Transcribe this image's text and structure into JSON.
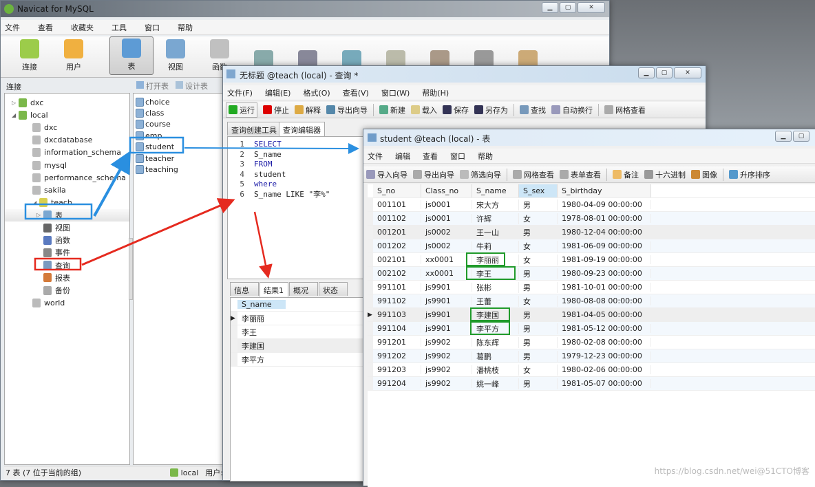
{
  "main_window": {
    "title": "Navicat for MySQL",
    "menu": [
      "文件",
      "查看",
      "收藏夹",
      "工具",
      "窗口",
      "帮助"
    ],
    "toolbar": [
      {
        "label": "连接",
        "icon": "connection-icon"
      },
      {
        "label": "用户",
        "icon": "user-icon"
      },
      {
        "label": "表",
        "icon": "table-icon",
        "selected": true
      },
      {
        "label": "视图",
        "icon": "view-icon"
      },
      {
        "label": "函数",
        "icon": "function-icon"
      }
    ],
    "connection_header": "连接",
    "object_toolbar": [
      "打开表",
      "设计表"
    ],
    "tree": [
      {
        "label": "dxc",
        "level": 0,
        "type": "connection",
        "expanded": false
      },
      {
        "label": "local",
        "level": 0,
        "type": "connection",
        "expanded": true
      },
      {
        "label": "dxc",
        "level": 1,
        "type": "database"
      },
      {
        "label": "dxcdatabase",
        "level": 1,
        "type": "database"
      },
      {
        "label": "information_schema",
        "level": 1,
        "type": "database"
      },
      {
        "label": "mysql",
        "level": 1,
        "type": "database"
      },
      {
        "label": "performance_schema",
        "level": 1,
        "type": "database"
      },
      {
        "label": "sakila",
        "level": 1,
        "type": "database"
      },
      {
        "label": "teach",
        "level": 1,
        "type": "database",
        "expanded": true
      },
      {
        "label": "表",
        "level": 2,
        "type": "tables",
        "selected": true
      },
      {
        "label": "视图",
        "level": 2,
        "type": "views"
      },
      {
        "label": "函数",
        "level": 2,
        "type": "functions"
      },
      {
        "label": "事件",
        "level": 2,
        "type": "events"
      },
      {
        "label": "查询",
        "level": 2,
        "type": "queries"
      },
      {
        "label": "报表",
        "level": 2,
        "type": "reports"
      },
      {
        "label": "备份",
        "level": 2,
        "type": "backups"
      },
      {
        "label": "world",
        "level": 1,
        "type": "database"
      }
    ],
    "tables": [
      "choice",
      "class",
      "course",
      "emp",
      "student",
      "teacher",
      "teaching"
    ],
    "status": {
      "left": "7 表 (7 位于当前的组)",
      "connection": "local",
      "user": "用户:"
    }
  },
  "query_window": {
    "title": "无标题 @teach (local) - 查询 *",
    "menu": [
      "文件(F)",
      "编辑(E)",
      "格式(O)",
      "查看(V)",
      "窗口(W)",
      "帮助(H)"
    ],
    "toolbar": [
      "运行",
      "停止",
      "解释",
      "导出向导",
      "新建",
      "载入",
      "保存",
      "另存为",
      "查找",
      "自动换行",
      "网格查看"
    ],
    "tabs": [
      "查询创建工具",
      "查询编辑器"
    ],
    "active_tab": "查询编辑器",
    "sql_lines": [
      "SELECT",
      "S_name",
      "FROM",
      "student",
      "where",
      "S_name LIKE \"李%\""
    ],
    "result_tabs": [
      "信息",
      "结果1",
      "概况",
      "状态"
    ],
    "active_result_tab": "结果1",
    "result_header": "S_name",
    "result_rows": [
      "李丽丽",
      "李王",
      "李建国",
      "李平方"
    ]
  },
  "table_window": {
    "title": "student @teach (local) - 表",
    "menu": [
      "文件",
      "编辑",
      "查看",
      "窗口",
      "帮助"
    ],
    "toolbar": [
      "导入向导",
      "导出向导",
      "筛选向导",
      "网格查看",
      "表单查看",
      "备注",
      "十六进制",
      "图像",
      "升序排序"
    ],
    "columns": [
      "S_no",
      "Class_no",
      "S_name",
      "S_sex",
      "S_birthday"
    ],
    "rows": [
      [
        "001101",
        "js0001",
        "宋大方",
        "男",
        "1980-04-09 00:00:00"
      ],
      [
        "001102",
        "js0001",
        "许辉",
        "女",
        "1978-08-01 00:00:00"
      ],
      [
        "001201",
        "js0002",
        "王一山",
        "男",
        "1980-12-04 00:00:00"
      ],
      [
        "001202",
        "js0002",
        "牛莉",
        "女",
        "1981-06-09 00:00:00"
      ],
      [
        "002101",
        "xx0001",
        "李丽丽",
        "女",
        "1981-09-19 00:00:00"
      ],
      [
        "002102",
        "xx0001",
        "李王",
        "男",
        "1980-09-23 00:00:00"
      ],
      [
        "991101",
        "js9901",
        "张彬",
        "男",
        "1981-10-01 00:00:00"
      ],
      [
        "991102",
        "js9901",
        "王蕾",
        "女",
        "1980-08-08 00:00:00"
      ],
      [
        "991103",
        "js9901",
        "李建国",
        "男",
        "1981-04-05 00:00:00"
      ],
      [
        "991104",
        "js9901",
        "李平方",
        "男",
        "1981-05-12 00:00:00"
      ],
      [
        "991201",
        "js9902",
        "陈东辉",
        "男",
        "1980-02-08 00:00:00"
      ],
      [
        "991202",
        "js9902",
        "葛鹏",
        "男",
        "1979-12-23 00:00:00"
      ],
      [
        "991203",
        "js9902",
        "潘桃枝",
        "女",
        "1980-02-06 00:00:00"
      ],
      [
        "991204",
        "js9902",
        "姚一峰",
        "男",
        "1981-05-07 00:00:00"
      ]
    ],
    "current_row": 8,
    "highlighted_rows": [
      4,
      5,
      8,
      9
    ]
  },
  "watermark": "https://blog.csdn.net/wei@51CTO博客",
  "colors": {
    "annotation_blue": "#2a8fe0",
    "annotation_red": "#e52a1f",
    "annotation_green": "#1f9a2a"
  }
}
